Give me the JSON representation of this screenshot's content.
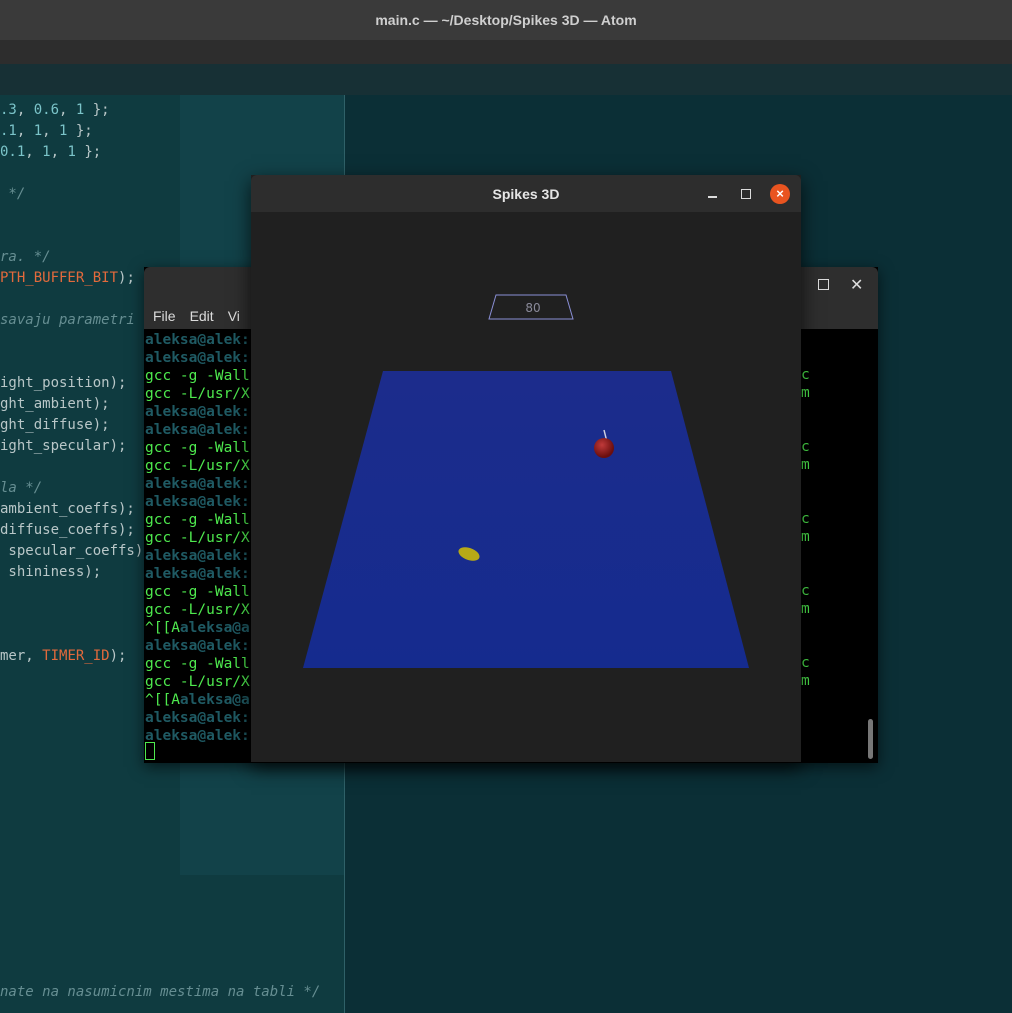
{
  "atom": {
    "window_title": "main.c — ~/Desktop/Spikes 3D — Atom",
    "code_lines": [
      {
        "pre": "",
        "num": ".3",
        "mid": ", ",
        "num2": "0.6",
        "mid2": ", ",
        "num3": "1",
        "post": " };"
      },
      {
        "pre": "",
        "num": ".1",
        "mid": ", ",
        "num2": "1",
        "mid2": ", ",
        "num3": "1",
        "post": " };"
      },
      {
        "pre": "",
        "num": "0.1",
        "mid": ", ",
        "num2": "1",
        "mid2": ", ",
        "num3": "1",
        "post": " };"
      }
    ],
    "comment_1": " */",
    "comment_2": "ra. */",
    "const_line_const": "PTH_BUFFER_BIT",
    "const_line_post": ");",
    "comment_3": "savaju parametri",
    "light_lines": [
      "ight_position);",
      "ght_ambient);",
      "ght_diffuse);",
      "ight_specular);"
    ],
    "comment_4": "la */",
    "coeff_lines": [
      "ambient_coeffs);",
      "diffuse_coeffs);",
      " specular_coeffs)",
      " shininess);"
    ],
    "timer_pre": "mer, ",
    "timer_const": "TIMER_ID",
    "timer_post": ");",
    "comment_bottom": "nate na nasumicnim mestima na tabli */"
  },
  "terminal": {
    "menu": [
      "File",
      "Edit",
      "Vi"
    ],
    "prompt": "aleksa@alek:",
    "gcc_compile": "gcc -g -Wall",
    "gcc_link": "gcc -L/usr/X",
    "up_arrow": "^[[A",
    "up_arrow_prompt": "aleksa@a",
    "tail_c": "c",
    "tail_m": "m"
  },
  "spikes": {
    "window_title": "Spikes 3D",
    "close_glyph": "×",
    "score": "80",
    "colors": {
      "board": "#1b2a8f",
      "ball": "#9a1a1a",
      "disc": "#b7a916"
    }
  }
}
